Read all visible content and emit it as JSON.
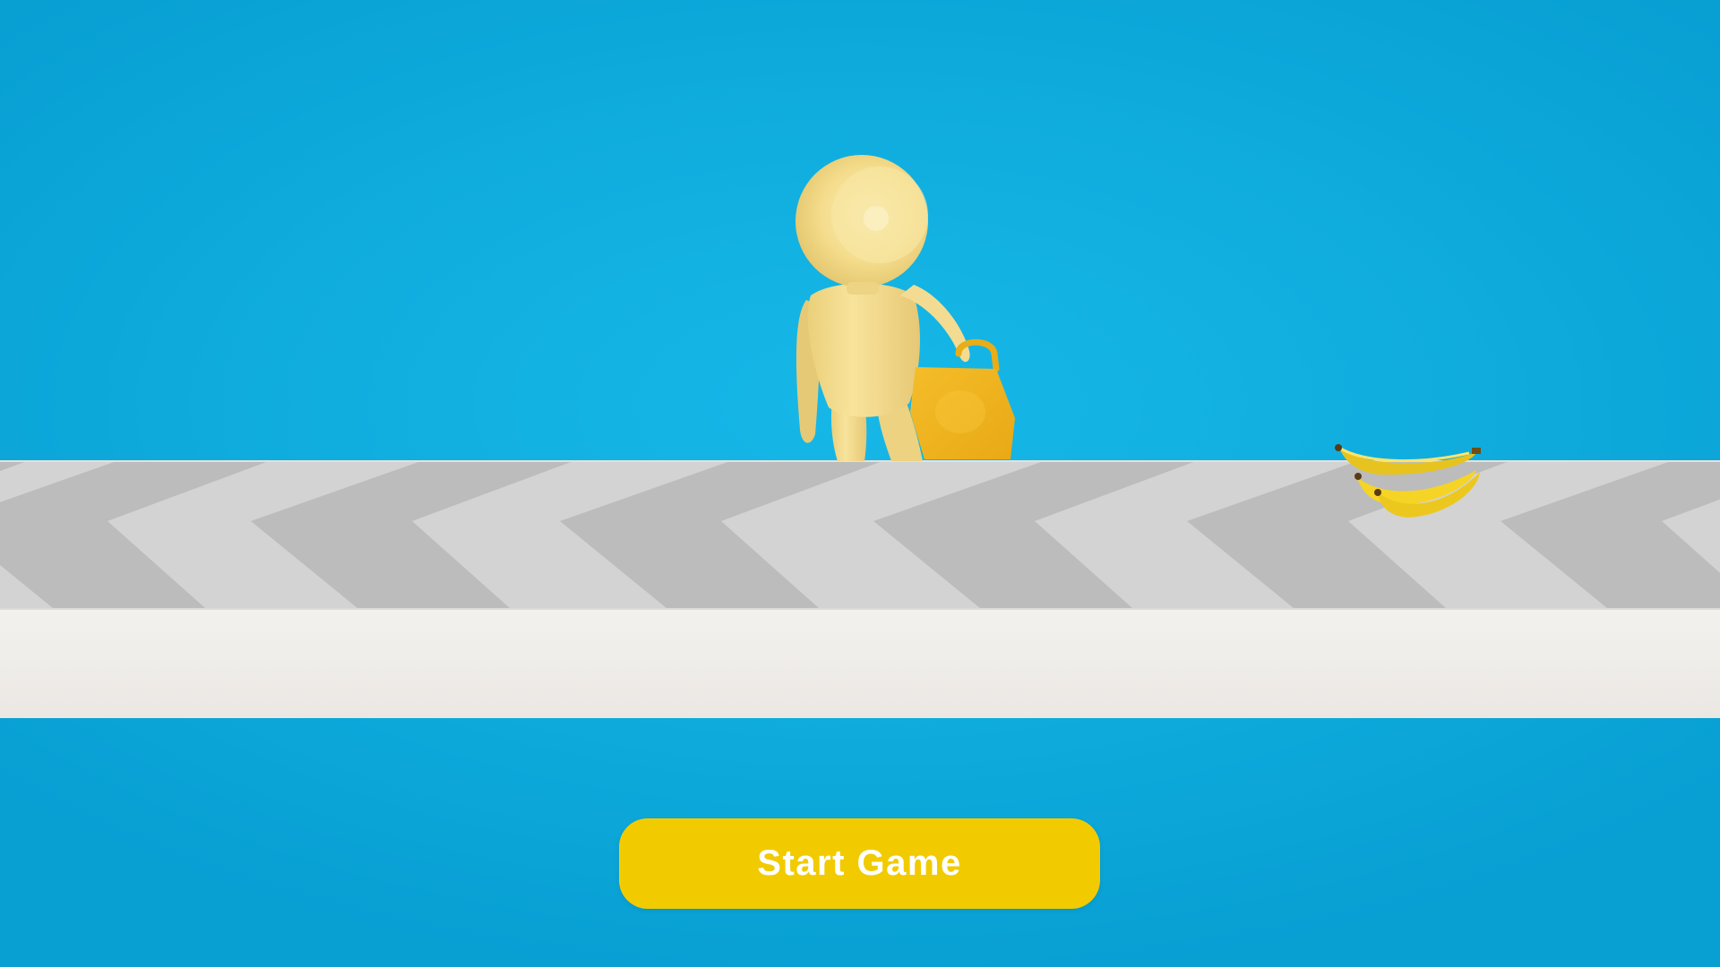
{
  "start_button": {
    "label": "Start Game",
    "color": "#f1cb00"
  },
  "colors": {
    "sky": "#10aedf",
    "track_light": "#d2d2d2",
    "track_dark": "#bcbcbc",
    "track_front": "#efedea",
    "character": "#f4dc8c",
    "bag": "#f0b71f",
    "banana": "#f5d425"
  },
  "scene": {
    "character": "yellow-stickman",
    "bag": "yellow-shopping-bag",
    "pickup": "banana-bunch"
  }
}
